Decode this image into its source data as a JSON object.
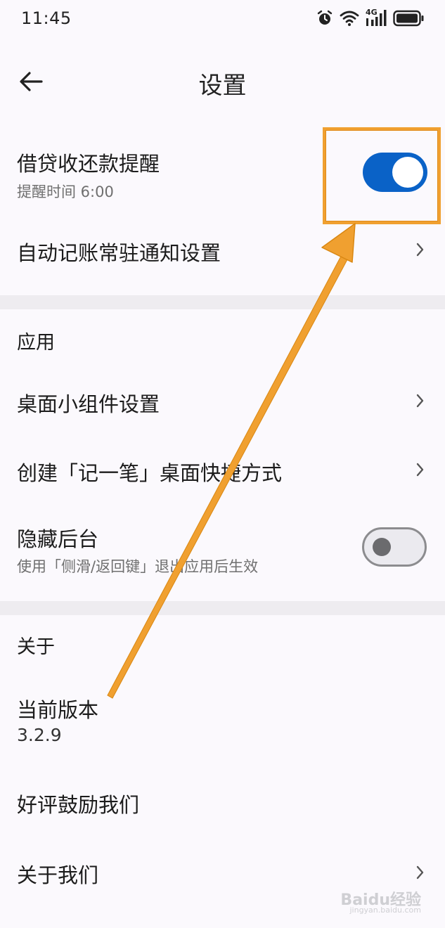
{
  "status_bar": {
    "time": "11:45",
    "network": "4G",
    "icons": [
      "alarm-icon",
      "wifi-icon",
      "signal-icon",
      "battery-icon"
    ]
  },
  "app_bar": {
    "title": "设置",
    "back_icon": "arrow-left-icon"
  },
  "rows": {
    "loan_reminder": {
      "title": "借贷收还款提醒",
      "subtitle": "提醒时间 6:00",
      "enabled": true
    },
    "auto_notify": {
      "title": "自动记账常驻通知设置"
    },
    "widget": {
      "title": "桌面小组件设置"
    },
    "shortcut": {
      "title": "创建「记一笔」桌面快捷方式"
    },
    "hide_bg": {
      "title": "隐藏后台",
      "subtitle": "使用「侧滑/返回键」退出应用后生效",
      "enabled": false
    },
    "version": {
      "title": "当前版本",
      "value": "3.2.9"
    },
    "rate": {
      "title": "好评鼓励我们"
    },
    "about_us": {
      "title": "关于我们"
    }
  },
  "sections": {
    "app": "应用",
    "about": "关于"
  },
  "watermark": {
    "main": "Baidu经验",
    "sub": "jingyan.baidu.com"
  },
  "colors": {
    "accent": "#0a62c7",
    "annotation": "#f0a030",
    "background": "#fbf9fd",
    "divider": "#eeecf0"
  }
}
